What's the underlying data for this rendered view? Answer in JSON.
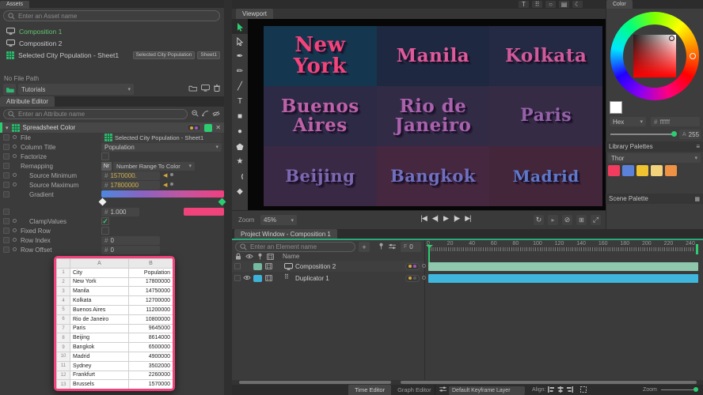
{
  "assets_panel": {
    "tab": "Assets",
    "search_placeholder": "Enter an Asset name",
    "items": [
      {
        "label": "Composition 1",
        "icon": "composition-icon",
        "selected": true,
        "tags": []
      },
      {
        "label": "Composition 2",
        "icon": "composition-icon",
        "selected": false,
        "tags": []
      },
      {
        "label": "Selected City Population - Sheet1",
        "icon": "spreadsheet-icon",
        "selected": false,
        "tags": [
          "Selected City Population",
          "Sheet1"
        ]
      }
    ],
    "file_path_label": "No File Path",
    "folder_value": "Tutorials",
    "path_icons": [
      "folder-icon",
      "monitor-icon",
      "trash-icon"
    ]
  },
  "attribute_editor": {
    "tab": "Attribute Editor",
    "search_placeholder": "Enter an Attribute name",
    "search_icons": [
      "search-filter-icon",
      "trace-icon",
      "hide-attributes-icon"
    ],
    "section_title": "Spreadsheet Color",
    "number_prefix": "#",
    "keyframe_dot_colors": [
      "#d4a93c",
      "#9b59b6"
    ],
    "accent_green": "#2ecc71",
    "gradient_stops": [
      "#4e87de",
      "#8a63c2",
      "#c355a0",
      "#f23f7f"
    ],
    "gradient_swatch": "#f0437c",
    "rows": [
      {
        "label": "File",
        "type": "file",
        "value": "Selected City Population - Sheet1",
        "indent": 0,
        "circle": true
      },
      {
        "label": "Column Title",
        "type": "dropdown",
        "value": "Population",
        "indent": 0,
        "circle": true
      },
      {
        "label": "Factorize",
        "type": "checkbox",
        "checked": false,
        "indent": 0,
        "circle": true
      },
      {
        "label": "Remapping",
        "type": "badge-dropdown",
        "badge": "Nr",
        "value": "Number Range To Color",
        "indent": 0,
        "circle": false
      },
      {
        "label": "Source Minimum",
        "type": "number",
        "value": "1570000.",
        "keyed": true,
        "indent": 1,
        "circle": true
      },
      {
        "label": "Source Maximum",
        "type": "number",
        "value": "17800000",
        "keyed": true,
        "indent": 1,
        "circle": true
      },
      {
        "label": "Gradient",
        "type": "gradient",
        "indent": 1,
        "circle": false
      },
      {
        "label": "",
        "type": "gradient-value",
        "value": "1.000",
        "indent": 1,
        "circle": false
      },
      {
        "label": "ClampValues",
        "type": "checkbox",
        "checked": true,
        "indent": 1,
        "circle": true
      },
      {
        "label": "Fixed Row",
        "type": "checkbox",
        "checked": false,
        "indent": 0,
        "circle": true
      },
      {
        "label": "Row Index",
        "type": "number",
        "value": "0",
        "indent": 0,
        "circle": true
      },
      {
        "label": "Row Offset",
        "type": "number",
        "value": "0",
        "indent": 0,
        "circle": true
      }
    ]
  },
  "spreadsheet": {
    "border_color": "#f0437c",
    "columns": [
      "A",
      "B"
    ],
    "rows": [
      {
        "n": "1",
        "a": "City",
        "b": "Population"
      },
      {
        "n": "2",
        "a": "New York",
        "b": "17800000"
      },
      {
        "n": "3",
        "a": "Manila",
        "b": "14750000"
      },
      {
        "n": "4",
        "a": "Kolkata",
        "b": "12700000"
      },
      {
        "n": "5",
        "a": "Buenos Aires",
        "b": "11200000"
      },
      {
        "n": "6",
        "a": "Rio de Janeiro",
        "b": "10800000"
      },
      {
        "n": "7",
        "a": "Paris",
        "b": "9645000"
      },
      {
        "n": "8",
        "a": "Beijing",
        "b": "8614000"
      },
      {
        "n": "9",
        "a": "Bangkok",
        "b": "6500000"
      },
      {
        "n": "10",
        "a": "Madrid",
        "b": "4900000"
      },
      {
        "n": "11",
        "a": "Sydney",
        "b": "3502000"
      },
      {
        "n": "12",
        "a": "Frankfurt",
        "b": "2260000"
      },
      {
        "n": "13",
        "a": "Brussels",
        "b": "1570000"
      }
    ]
  },
  "viewport": {
    "tab": "Viewport",
    "tools": [
      "select-tool",
      "direct-select-tool",
      "pen-tool",
      "pencil-tool",
      "line-tool",
      "text-tool",
      "rectangle-tool",
      "ellipse-tool",
      "polygon-tool",
      "star-tool",
      "arc-tool",
      "diamond-tool"
    ],
    "top_icons": [
      "text-frame-icon",
      "grid-overlay-icon",
      "mask-icon",
      "render-icon",
      "theme-icon"
    ],
    "cities": [
      {
        "name": "New York",
        "color": "#f4437b",
        "bg": "#14364f"
      },
      {
        "name": "Manila",
        "color": "#de5a9a",
        "bg": "#1f2841"
      },
      {
        "name": "Kolkata",
        "color": "#d25a9c",
        "bg": "#242a43"
      },
      {
        "name": "Buenos Aires",
        "color": "#bd62a8",
        "bg": "#2c2a45"
      },
      {
        "name": "Rio de Janeiro",
        "color": "#aa62ad",
        "bg": "#322b46"
      },
      {
        "name": "Paris",
        "color": "#9562a9",
        "bg": "#362b45"
      },
      {
        "name": "Beijing",
        "color": "#7d68b2",
        "bg": "#3a2944"
      },
      {
        "name": "Bangkok",
        "color": "#7070c0",
        "bg": "#45273f"
      },
      {
        "name": "Madrid",
        "color": "#5e79ca",
        "bg": "#44263b"
      }
    ],
    "zoom_label": "Zoom",
    "zoom_value": "45%",
    "playback_icons": [
      "go-start",
      "step-back",
      "play",
      "step-forward",
      "go-end"
    ],
    "bar_icons": [
      "sync-icon",
      "proxy-play-icon",
      "mute-icon",
      "duplicate-icon",
      "fit-view-icon"
    ]
  },
  "project_window": {
    "tab": "Project Window - Composition 1",
    "search_placeholder": "Enter an Element name",
    "search_icons": [
      "pin-icon",
      "sliders-icon"
    ],
    "frame_value": "0",
    "header_icons": [
      "lock-icon",
      "eye-icon",
      "pin-icon",
      "film-icon"
    ],
    "name_header": "Name",
    "layers": [
      {
        "name": "Composition 2",
        "icon": "composition-icon",
        "swatch": "#74b9a0",
        "eye": false,
        "dots": [
          "#d4a93c",
          "#9b59b6"
        ]
      },
      {
        "name": "Duplicator 1",
        "icon": "duplicator-icon",
        "swatch": "#3eb1d6",
        "eye": true,
        "dots": [
          "#d4a93c",
          "#5a5a5a"
        ]
      }
    ],
    "ruler_ticks": [
      "0",
      "20",
      "40",
      "60",
      "80",
      "100",
      "120",
      "140",
      "160",
      "180",
      "200",
      "220",
      "240"
    ],
    "tracks": [
      {
        "color": "#8fc7ad"
      },
      {
        "color": "#3fb7dc"
      }
    ],
    "playhead_color": "#2ecc71"
  },
  "color_panel": {
    "tab": "Color",
    "hex_label": "Hex",
    "hex_prefix": "#",
    "hex_value": "ffffff",
    "alpha_prefix": "A",
    "alpha_value": "255",
    "current_swatch": "#ffffff",
    "library_palettes_label": "Library Palettes",
    "palette_name": "Thor",
    "palette_colors": [
      "#f23c5f",
      "#5b82d8",
      "#f0c330",
      "#f3d27c",
      "#ef9243"
    ],
    "scene_palette_label": "Scene Palette"
  },
  "bottom_bar": {
    "tabs": [
      {
        "label": "Time Editor",
        "active": true
      },
      {
        "label": "Graph Editor",
        "active": false
      }
    ],
    "keyframe_layer_value": "Default Keyframe Layer",
    "align_label": "Align:",
    "align_icons": [
      "align-left-icon",
      "align-center-icon",
      "align-right-icon"
    ],
    "zoom_label": "Zoom"
  }
}
